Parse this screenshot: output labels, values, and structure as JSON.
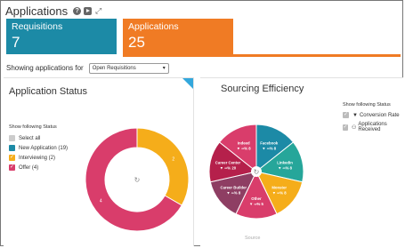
{
  "header": {
    "title": "Applications",
    "icons": [
      "help-icon",
      "video-icon",
      "expand-icon"
    ]
  },
  "tiles": {
    "requisitions": {
      "label": "Requisitions",
      "count": "7",
      "color": "#1c8aa6"
    },
    "applications": {
      "label": "Applications",
      "count": "25",
      "color": "#f07b24"
    }
  },
  "filter": {
    "label": "Showing applications for",
    "selected": "Open Requisitions"
  },
  "application_status": {
    "title": "Application Status",
    "legend_heading": "Show following Status",
    "legend": [
      {
        "label": "Select all",
        "color": "#cccccc",
        "checked": false
      },
      {
        "label": "New Application (19)",
        "color": "#1c8aa6",
        "checked": false
      },
      {
        "label": "Interviewing (2)",
        "color": "#f5ad1a",
        "checked": true
      },
      {
        "label": "Offer (4)",
        "color": "#d93d6b",
        "checked": true
      }
    ],
    "refresh_icon": "refresh-icon"
  },
  "sourcing_efficiency": {
    "title": "Sourcing Efficiency",
    "legend_heading": "Show following Status",
    "legend": [
      {
        "label": "Conversion Rate",
        "icon": "filter-icon",
        "checked": true
      },
      {
        "label": "Applications Received",
        "icon": "people-icon",
        "checked": true
      }
    ],
    "source_label": "Source"
  },
  "chart_data": [
    {
      "type": "pie",
      "title": "Application Status",
      "donut": true,
      "slices": [
        {
          "name": "Interviewing",
          "value": 2,
          "label": "2",
          "color": "#f5ad1a"
        },
        {
          "name": "Offer",
          "value": 4,
          "label": "4",
          "color": "#d93d6b"
        }
      ]
    },
    {
      "type": "pie",
      "title": "Sourcing Efficiency",
      "x_label": "Source",
      "slices": [
        {
          "name": "Facebook",
          "value": 1,
          "line2": "▼ ∞% 8",
          "color": "#1c8aa6"
        },
        {
          "name": "LinkedIn",
          "value": 1,
          "line2": "▼ ∞% 8",
          "color": "#26a69a"
        },
        {
          "name": "Monster",
          "value": 1,
          "line2": "▼ ∞% 8",
          "color": "#f5ad1a"
        },
        {
          "name": "Other",
          "value": 1,
          "line2": "▼ ∞% 5",
          "color": "#d93d6b"
        },
        {
          "name": "Career Builder",
          "value": 1,
          "line2": "▼ ∞% 8",
          "color": "#8e3e63"
        },
        {
          "name": "Career Center",
          "value": 1,
          "line2": "▼ ∞% 20",
          "color": "#b5204b"
        },
        {
          "name": "Indeed",
          "value": 1,
          "line2": "▼ ∞% 8",
          "color": "#d93d6b"
        }
      ]
    }
  ]
}
